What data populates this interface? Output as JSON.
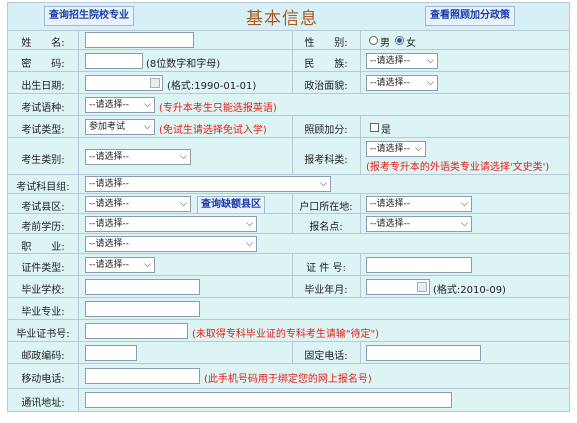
{
  "header": {
    "btn_left": "查询招生院校专业",
    "title": "基本信息",
    "btn_right": "查看照顾加分政策"
  },
  "select_default": "--请选择--",
  "form": {
    "name": {
      "label": "姓　　名:",
      "value": ""
    },
    "gender": {
      "label": "性　　别:",
      "male": "男",
      "female": "女",
      "selected": "女"
    },
    "password": {
      "label": "密　　码:",
      "hint": "(8位数字和字母)"
    },
    "ethnicity": {
      "label": "民　　族:"
    },
    "birthdate": {
      "label": "出生日期:",
      "hint": "(格式:1990-01-01)"
    },
    "political": {
      "label": "政治面貌:"
    },
    "language": {
      "label": "考试语种:",
      "hint": "(专升本考生只能选报英语)"
    },
    "exam_type": {
      "label": "考试类型:",
      "value": "参加考试",
      "hint": "(免试生请选择免试入学)"
    },
    "bonus": {
      "label": "照顾加分:",
      "option": "是"
    },
    "category": {
      "label": "考生类别:"
    },
    "subject_category": {
      "label": "报考科类:",
      "hint": "(报考专升本的外语类专业请选择'文史类')"
    },
    "subject_group": {
      "label": "考试科目组:"
    },
    "district": {
      "label": "考试县区:",
      "button": "查询缺额县区"
    },
    "hukou": {
      "label": "户口所在地:"
    },
    "education": {
      "label": "考前学历:"
    },
    "site": {
      "label": "报名点:"
    },
    "occupation": {
      "label": "职　　业:"
    },
    "id_type": {
      "label": "证件类型:"
    },
    "id_number": {
      "label": "证 件 号:"
    },
    "school": {
      "label": "毕业学校:"
    },
    "grad_date": {
      "label": "毕业年月:",
      "hint": "(格式:2010-09)"
    },
    "major": {
      "label": "毕业专业:"
    },
    "cert_no": {
      "label": "毕业证书号:",
      "hint": "(未取得专科毕业证的专科考生请输\"待定\")"
    },
    "postcode": {
      "label": "邮政编码:"
    },
    "phone": {
      "label": "固定电话:"
    },
    "mobile": {
      "label": "移动电话:",
      "hint": "(此手机号码用于绑定您的网上报名号)"
    },
    "address": {
      "label": "通讯地址:"
    }
  }
}
